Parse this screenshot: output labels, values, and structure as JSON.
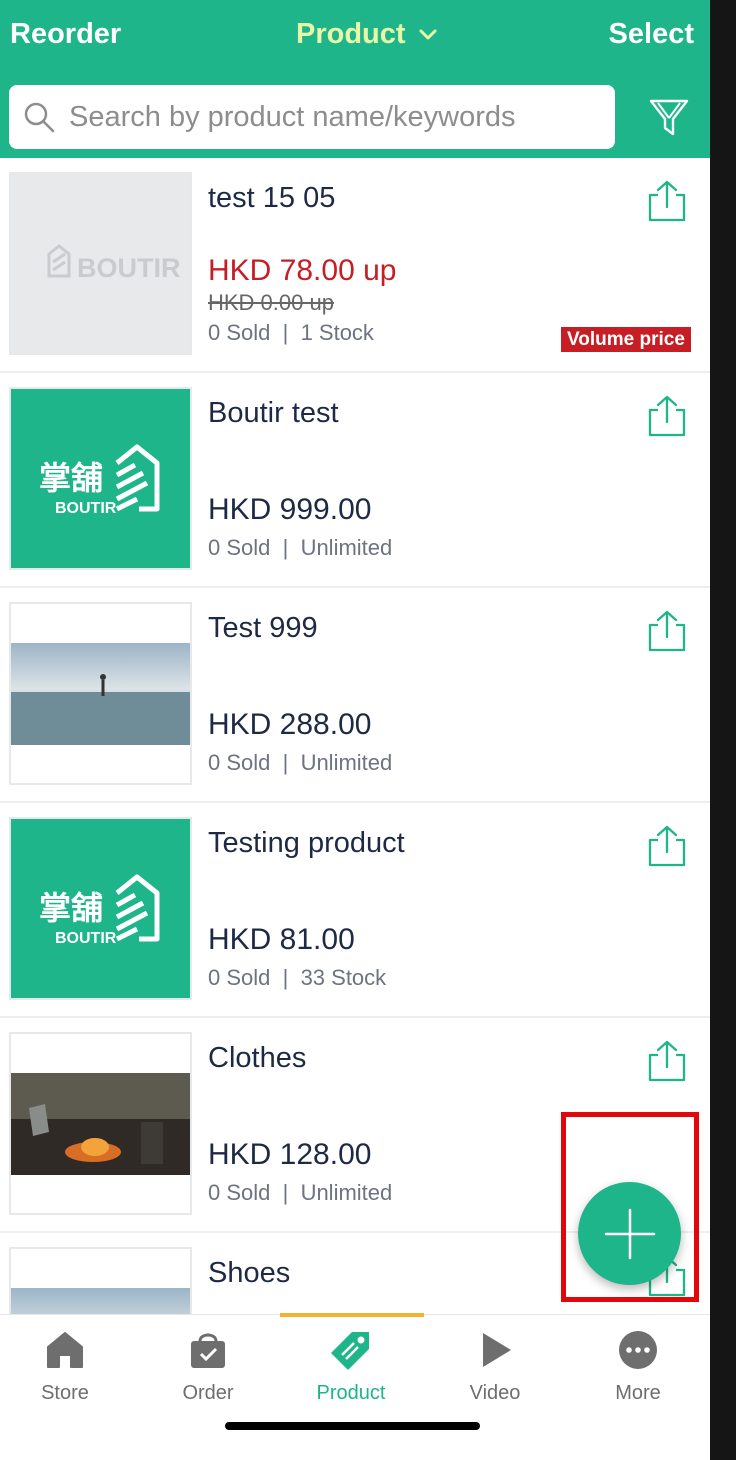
{
  "header": {
    "left_label": "Reorder",
    "title": "Product",
    "right_label": "Select",
    "search_placeholder": "Search by product name/keywords",
    "color": "#1db589"
  },
  "products": [
    {
      "name": "test 15 05",
      "price": "HKD 78.00 up",
      "original_price": "HKD 0.00 up",
      "sold": "0 Sold",
      "stock": "1 Stock",
      "badge": "Volume price",
      "image": "BOUTIR"
    },
    {
      "name": "Boutir test",
      "price": "HKD 999.00",
      "sold": "0 Sold",
      "stock": "Unlimited",
      "image": "掌舖 BOUTIR"
    },
    {
      "name": "Test 999",
      "price": "HKD 288.00",
      "sold": "0 Sold",
      "stock": "Unlimited",
      "image": "sea-photo"
    },
    {
      "name": "Testing product",
      "price": "HKD 81.00",
      "sold": "0 Sold",
      "stock": "33 Stock",
      "image": "掌舖 BOUTIR"
    },
    {
      "name": "Clothes",
      "price": "HKD 128.00",
      "sold": "0 Sold",
      "stock": "Unlimited",
      "image": "campfire-photo"
    },
    {
      "name": "Shoes",
      "image": "sea-photo"
    }
  ],
  "tabs": [
    {
      "label": "Store",
      "icon": "store-icon"
    },
    {
      "label": "Order",
      "icon": "bag-icon"
    },
    {
      "label": "Product",
      "icon": "tag-icon",
      "active": true
    },
    {
      "label": "Video",
      "icon": "play-icon"
    },
    {
      "label": "More",
      "icon": "more-icon"
    }
  ],
  "accent_colors": {
    "brand_green": "#1db589",
    "price_red": "#c51e24",
    "title_navy": "#1e2a45",
    "tab_indicator": "#f3b231",
    "highlight_red": "#e1070a"
  }
}
